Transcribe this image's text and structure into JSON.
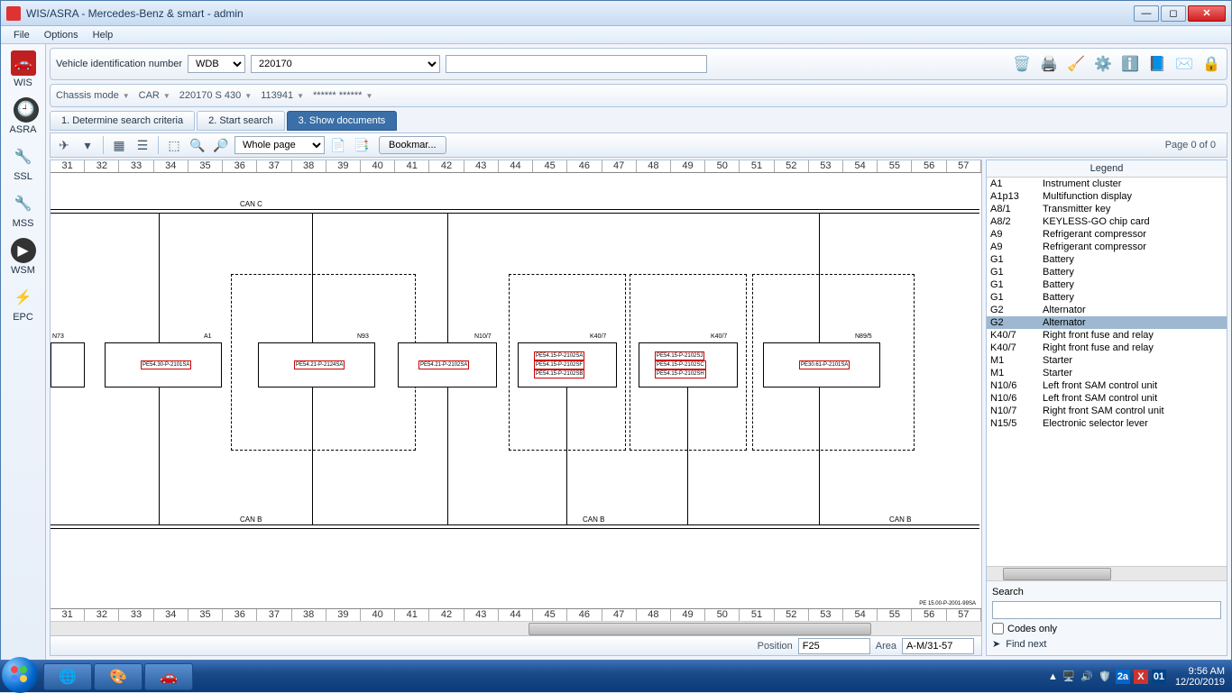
{
  "window": {
    "title": "WIS/ASRA - Mercedes-Benz & smart - admin"
  },
  "menu": {
    "file": "File",
    "options": "Options",
    "help": "Help"
  },
  "sidebar": {
    "items": [
      {
        "label": "WIS"
      },
      {
        "label": "ASRA"
      },
      {
        "label": "SSL"
      },
      {
        "label": "MSS"
      },
      {
        "label": "WSM"
      },
      {
        "label": "EPC"
      }
    ]
  },
  "vin": {
    "label": "Vehicle identification number",
    "prefix": "WDB",
    "value": "220170"
  },
  "chassis": {
    "mode_label": "Chassis mode",
    "car": "CAR",
    "model": "220170 S 430",
    "engine": "113941",
    "extra": "****** ******"
  },
  "tabs": {
    "t1": "1. Determine search criteria",
    "t2": "2. Start search",
    "t3": "3. Show documents"
  },
  "toolbar": {
    "zoom": "Whole page",
    "bookmark": "Bookmar...",
    "page_info": "Page 0 of 0"
  },
  "diagram": {
    "can_c": "CAN C",
    "can_b": "CAN B",
    "boxes": {
      "n73": "N73",
      "a1": "A1",
      "n93": "N93",
      "n107": "N10/7",
      "k407": "K40/7",
      "k407b": "K40/7",
      "n89": "N89/5"
    },
    "refs": {
      "a1": "PE54.30-P-2101SA",
      "n93": "PE54.21-P-2124SA",
      "n107": "PE54.21-P-2102SA",
      "k407a": "PE54.15-P-2102SA",
      "k407b": "PE54.15-P-2102SF",
      "k407c": "PE54.15-P-2102SB",
      "k407d": "PE54.15-P-2102SJ",
      "k407e": "PE54.15-P-2102SC",
      "k407f": "PE54.15-P-2102SH",
      "n89": "PE30.61-P-2101SA"
    },
    "footer_ref": "PE 15.00-P-2001-99SA"
  },
  "legend": {
    "header": "Legend",
    "items": [
      {
        "code": "A1",
        "desc": "Instrument cluster"
      },
      {
        "code": "A1p13",
        "desc": "Multifunction display"
      },
      {
        "code": "A8/1",
        "desc": "Transmitter key"
      },
      {
        "code": "A8/2",
        "desc": "KEYLESS-GO chip card"
      },
      {
        "code": "A9",
        "desc": "Refrigerant compressor"
      },
      {
        "code": "A9",
        "desc": "Refrigerant compressor"
      },
      {
        "code": "G1",
        "desc": "Battery"
      },
      {
        "code": "G1",
        "desc": "Battery"
      },
      {
        "code": "G1",
        "desc": "Battery"
      },
      {
        "code": "G1",
        "desc": "Battery"
      },
      {
        "code": "G2",
        "desc": "Alternator"
      },
      {
        "code": "G2",
        "desc": "Alternator",
        "sel": true
      },
      {
        "code": "K40/7",
        "desc": "Right front fuse and relay"
      },
      {
        "code": "K40/7",
        "desc": "Right front fuse and relay"
      },
      {
        "code": "M1",
        "desc": "Starter"
      },
      {
        "code": "M1",
        "desc": "Starter"
      },
      {
        "code": "N10/6",
        "desc": "Left front SAM control unit"
      },
      {
        "code": "N10/6",
        "desc": "Left front SAM control unit"
      },
      {
        "code": "N10/7",
        "desc": "Right front SAM control unit"
      },
      {
        "code": "N15/5",
        "desc": "Electronic selector lever"
      }
    ],
    "search_label": "Search",
    "codes_only": "Codes only",
    "find_next": "Find next"
  },
  "status": {
    "pos_label": "Position",
    "pos": "F25",
    "area_label": "Area",
    "area": "A-M/31-57"
  },
  "taskbar": {
    "time": "9:56 AM",
    "date": "12/20/2019"
  }
}
